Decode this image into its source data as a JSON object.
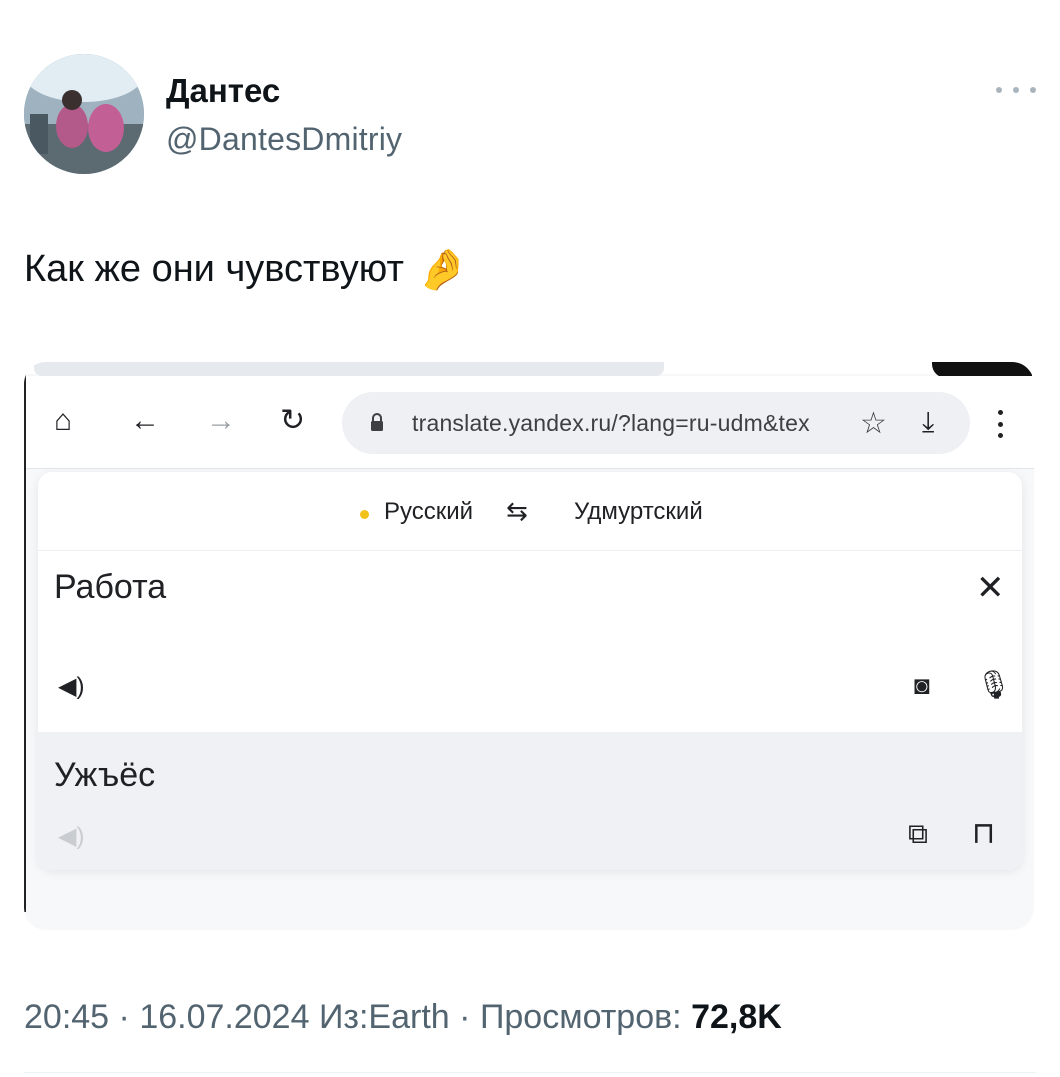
{
  "author": {
    "display_name": "Дантес",
    "handle": "@DantesDmitriy"
  },
  "tweet": {
    "text": "Как же они чувствуют",
    "emoji": "🤌"
  },
  "embedded": {
    "url": "translate.yandex.ru/?lang=ru-udm&tex",
    "source_language": "Русский",
    "target_language": "Удмуртский",
    "source_text": "Работа",
    "translation": "Ужъёс"
  },
  "meta": {
    "time": "20:45",
    "date": "16.07.2024",
    "source": "Из:Earth",
    "views_label": "Просмотров:",
    "views_count": "72,8K"
  },
  "colors": {
    "handle": "#536471",
    "yandex_dot": "#f2c11c",
    "result_bg": "#eff1f5"
  }
}
